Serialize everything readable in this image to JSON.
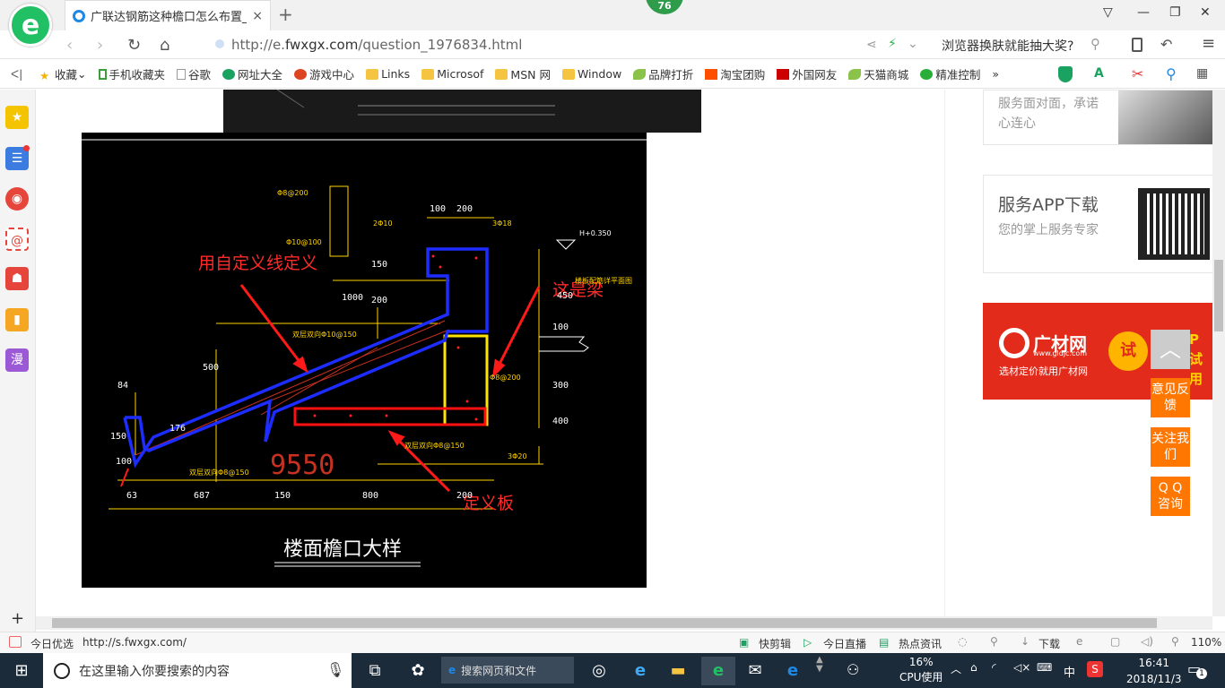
{
  "tab": {
    "title": "广联达钢筋这种檐口怎么布置_广",
    "close": "×",
    "new": "+"
  },
  "badge": "76",
  "window_buttons": [
    "▽",
    "—",
    "❐",
    "✕"
  ],
  "address": {
    "prefix": "http://e.",
    "domain": "fwxgx.com",
    "path": "/question_1976834.html",
    "promo": "浏览器换肤就能抽大奖?"
  },
  "bookmarks": [
    {
      "label": "收藏",
      "icon": "star-icon"
    },
    {
      "label": "手机收藏夹",
      "icon": "phone-icon"
    },
    {
      "label": "谷歌",
      "icon": "page-icon"
    },
    {
      "label": "网址大全",
      "icon": "globe-icon"
    },
    {
      "label": "游戏中心",
      "icon": "game-icon"
    },
    {
      "label": "Links",
      "icon": "folder-icon"
    },
    {
      "label": "Microsof",
      "icon": "folder-icon"
    },
    {
      "label": "MSN 网",
      "icon": "folder-icon"
    },
    {
      "label": "Window",
      "icon": "folder-icon"
    },
    {
      "label": "品牌打折",
      "icon": "leaf-icon"
    },
    {
      "label": "淘宝团购",
      "icon": "taobao-icon"
    },
    {
      "label": "外国网友",
      "icon": "flag-icon"
    },
    {
      "label": "天猫商城",
      "icon": "leaf-icon"
    },
    {
      "label": "精准控制",
      "icon": "wechat-icon"
    }
  ],
  "bookmarks_more": "»",
  "sidebar": {
    "comic": "漫",
    "add": "+"
  },
  "cad": {
    "title": "楼面檐口大样",
    "notes": {
      "custom_line": "用自定义线定义",
      "beam": "这是梁",
      "slab": "定义板"
    },
    "dims": [
      "100",
      "200",
      "150",
      "200",
      "1000",
      "500",
      "450",
      "100",
      "300",
      "400",
      "84",
      "150",
      "100",
      "176",
      "63",
      "687",
      "150",
      "800",
      "200"
    ],
    "big_dim": "9550",
    "labels": [
      "Φ8@200",
      "Φ10@100",
      "2Φ10",
      "3Φ18",
      "H+0.350",
      "楼板配筋详平面图",
      "双层双向Φ10@150",
      "Φ8@200",
      "双层双向Φ8@150",
      "双层双向Φ8@150",
      "3Φ20"
    ]
  },
  "right": {
    "card1_text": "服务面对面，承诺心连心",
    "app_title": "服务APP下载",
    "app_sub": "您的掌上服务专家",
    "ad_brand": "广材网",
    "ad_site": "www.gldjc.com",
    "ad_slogan": "选材定价就用广材网",
    "ad_try": "试",
    "ad_tail": "P 试用",
    "feedback": "意见反馈",
    "follow": "关注我们",
    "qq": "Q Q 咨询",
    "top": "︿"
  },
  "status": {
    "left": "今日优选",
    "url": "http://s.fwxgx.com/",
    "items": [
      "快剪辑",
      "今日直播",
      "热点资讯",
      "下载"
    ],
    "zoom": "110%"
  },
  "taskbar": {
    "search": "在这里输入你要搜索的内容",
    "search2": "搜索网页和文件",
    "cpu_pct": "16%",
    "cpu_label": "CPU使用",
    "ime": "中",
    "time": "16:41",
    "date": "2018/11/3",
    "notify_count": "1"
  }
}
